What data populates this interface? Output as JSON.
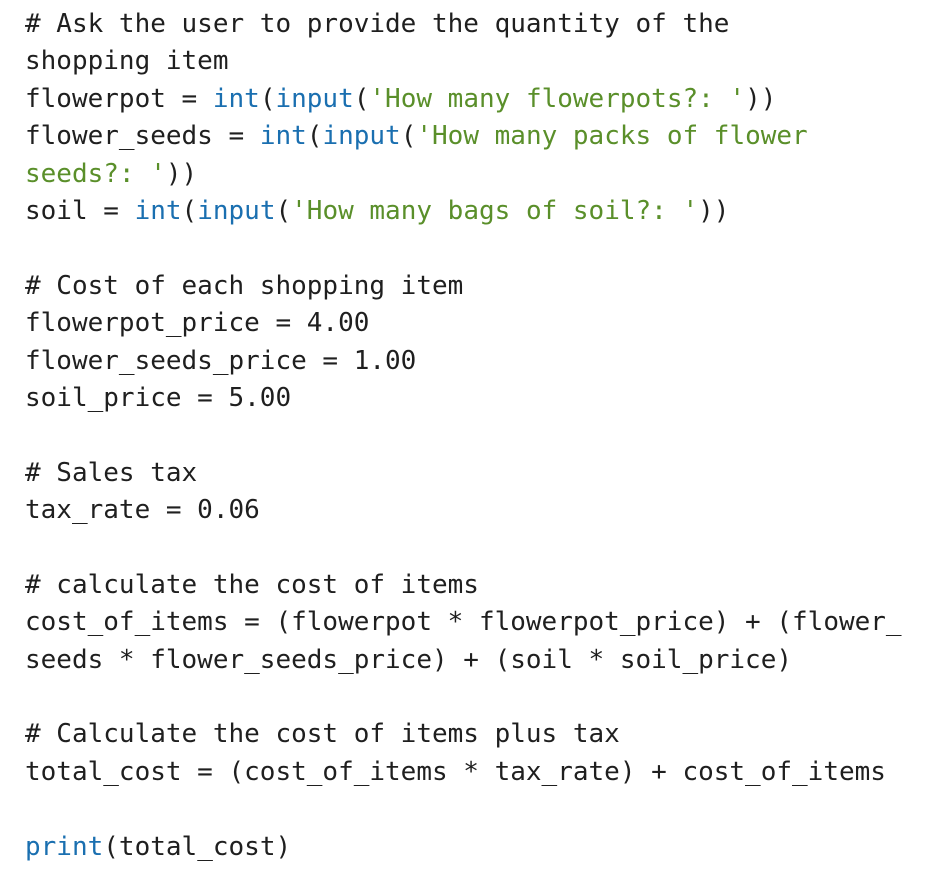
{
  "code": {
    "lines": [
      {
        "tokens": [
          {
            "t": "comment",
            "v": "# Ask the user to provide the quantity of the"
          }
        ]
      },
      {
        "tokens": [
          {
            "t": "comment",
            "v": "shopping item"
          }
        ]
      },
      {
        "tokens": [
          {
            "t": "plain",
            "v": "flowerpot = "
          },
          {
            "t": "builtin",
            "v": "int"
          },
          {
            "t": "plain",
            "v": "("
          },
          {
            "t": "builtin",
            "v": "input"
          },
          {
            "t": "plain",
            "v": "("
          },
          {
            "t": "string",
            "v": "'How many flowerpots?: '"
          },
          {
            "t": "plain",
            "v": "))"
          }
        ]
      },
      {
        "tokens": [
          {
            "t": "plain",
            "v": "flower_seeds = "
          },
          {
            "t": "builtin",
            "v": "int"
          },
          {
            "t": "plain",
            "v": "("
          },
          {
            "t": "builtin",
            "v": "input"
          },
          {
            "t": "plain",
            "v": "("
          },
          {
            "t": "string",
            "v": "'How many packs of flower"
          }
        ]
      },
      {
        "tokens": [
          {
            "t": "string",
            "v": "seeds?: '"
          },
          {
            "t": "plain",
            "v": "))"
          }
        ]
      },
      {
        "tokens": [
          {
            "t": "plain",
            "v": "soil = "
          },
          {
            "t": "builtin",
            "v": "int"
          },
          {
            "t": "plain",
            "v": "("
          },
          {
            "t": "builtin",
            "v": "input"
          },
          {
            "t": "plain",
            "v": "("
          },
          {
            "t": "string",
            "v": "'How many bags of soil?: '"
          },
          {
            "t": "plain",
            "v": "))"
          }
        ]
      },
      {
        "tokens": []
      },
      {
        "tokens": [
          {
            "t": "comment",
            "v": "# Cost of each shopping item"
          }
        ]
      },
      {
        "tokens": [
          {
            "t": "plain",
            "v": "flowerpot_price = 4.00"
          }
        ]
      },
      {
        "tokens": [
          {
            "t": "plain",
            "v": "flower_seeds_price = 1.00"
          }
        ]
      },
      {
        "tokens": [
          {
            "t": "plain",
            "v": "soil_price = 5.00"
          }
        ]
      },
      {
        "tokens": []
      },
      {
        "tokens": [
          {
            "t": "comment",
            "v": "# Sales tax"
          }
        ]
      },
      {
        "tokens": [
          {
            "t": "plain",
            "v": "tax_rate = 0.06"
          }
        ]
      },
      {
        "tokens": []
      },
      {
        "tokens": [
          {
            "t": "comment",
            "v": "# calculate the cost of items"
          }
        ]
      },
      {
        "tokens": [
          {
            "t": "plain",
            "v": "cost_of_items = (flowerpot * flowerpot_price) + (flower_"
          }
        ]
      },
      {
        "tokens": [
          {
            "t": "plain",
            "v": "seeds * flower_seeds_price) + (soil * soil_price)"
          }
        ]
      },
      {
        "tokens": []
      },
      {
        "tokens": [
          {
            "t": "comment",
            "v": "# Calculate the cost of items plus tax"
          }
        ]
      },
      {
        "tokens": [
          {
            "t": "plain",
            "v": "total_cost = (cost_of_items * tax_rate) + cost_of_items"
          }
        ]
      },
      {
        "tokens": []
      },
      {
        "tokens": [
          {
            "t": "builtin",
            "v": "print"
          },
          {
            "t": "plain",
            "v": "(total_cost)"
          }
        ]
      }
    ]
  },
  "colors": {
    "text": "#1f1f1f",
    "builtin": "#1a6fb0",
    "string": "#5a8f2a",
    "background": "#ffffff"
  }
}
